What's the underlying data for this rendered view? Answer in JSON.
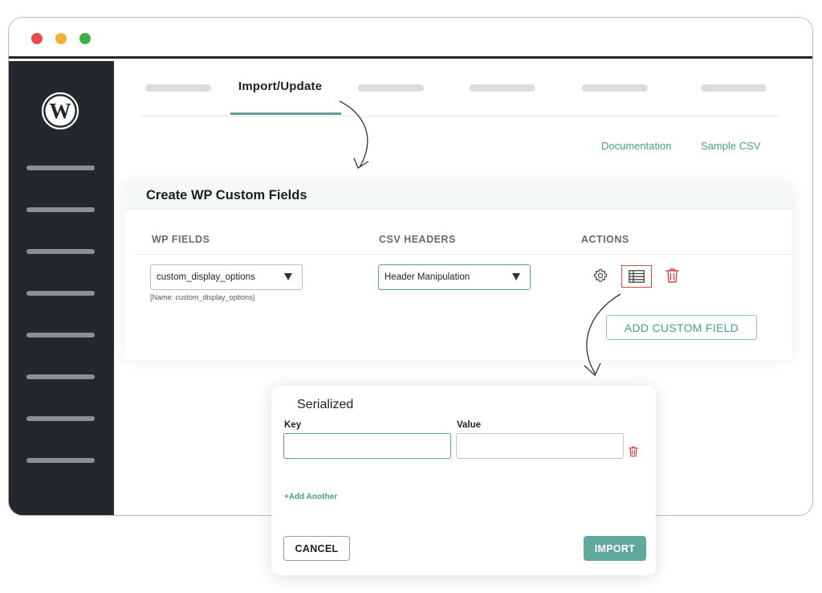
{
  "window": {
    "controls": {
      "close_color": "#e84b4b",
      "minimize_color": "#f0b23a",
      "maximize_color": "#3fb049"
    }
  },
  "sidebar": {
    "logo_icon": "wordpress-logo-icon",
    "item_count": 8
  },
  "tabs": {
    "active_label": "Import/Update"
  },
  "links": {
    "documentation": "Documentation",
    "sample_csv": "Sample CSV"
  },
  "card": {
    "title": "Create WP Custom Fields",
    "columns": {
      "wp_fields": "WP FIELDS",
      "csv_headers": "CSV HEADERS",
      "actions": "ACTIONS"
    },
    "wp_field_select": {
      "value": "custom_display_options",
      "hint": "[Name: custom_display_options]"
    },
    "csv_header_select": {
      "value": "Header Manipulation"
    },
    "action_icons": [
      "gear-icon",
      "table-icon",
      "trash-icon"
    ],
    "add_button": "ADD CUSTOM FIELD"
  },
  "modal": {
    "title": "Serialized",
    "key_label": "Key",
    "value_label": "Value",
    "key_value": "",
    "value_value": "",
    "add_another": "+Add Another",
    "cancel": "CANCEL",
    "import": "IMPORT"
  },
  "colors": {
    "accent": "#5fa89c",
    "accent_text": "#4a9d8f",
    "sidebar_bg": "#23282d",
    "danger": "#d84848"
  }
}
